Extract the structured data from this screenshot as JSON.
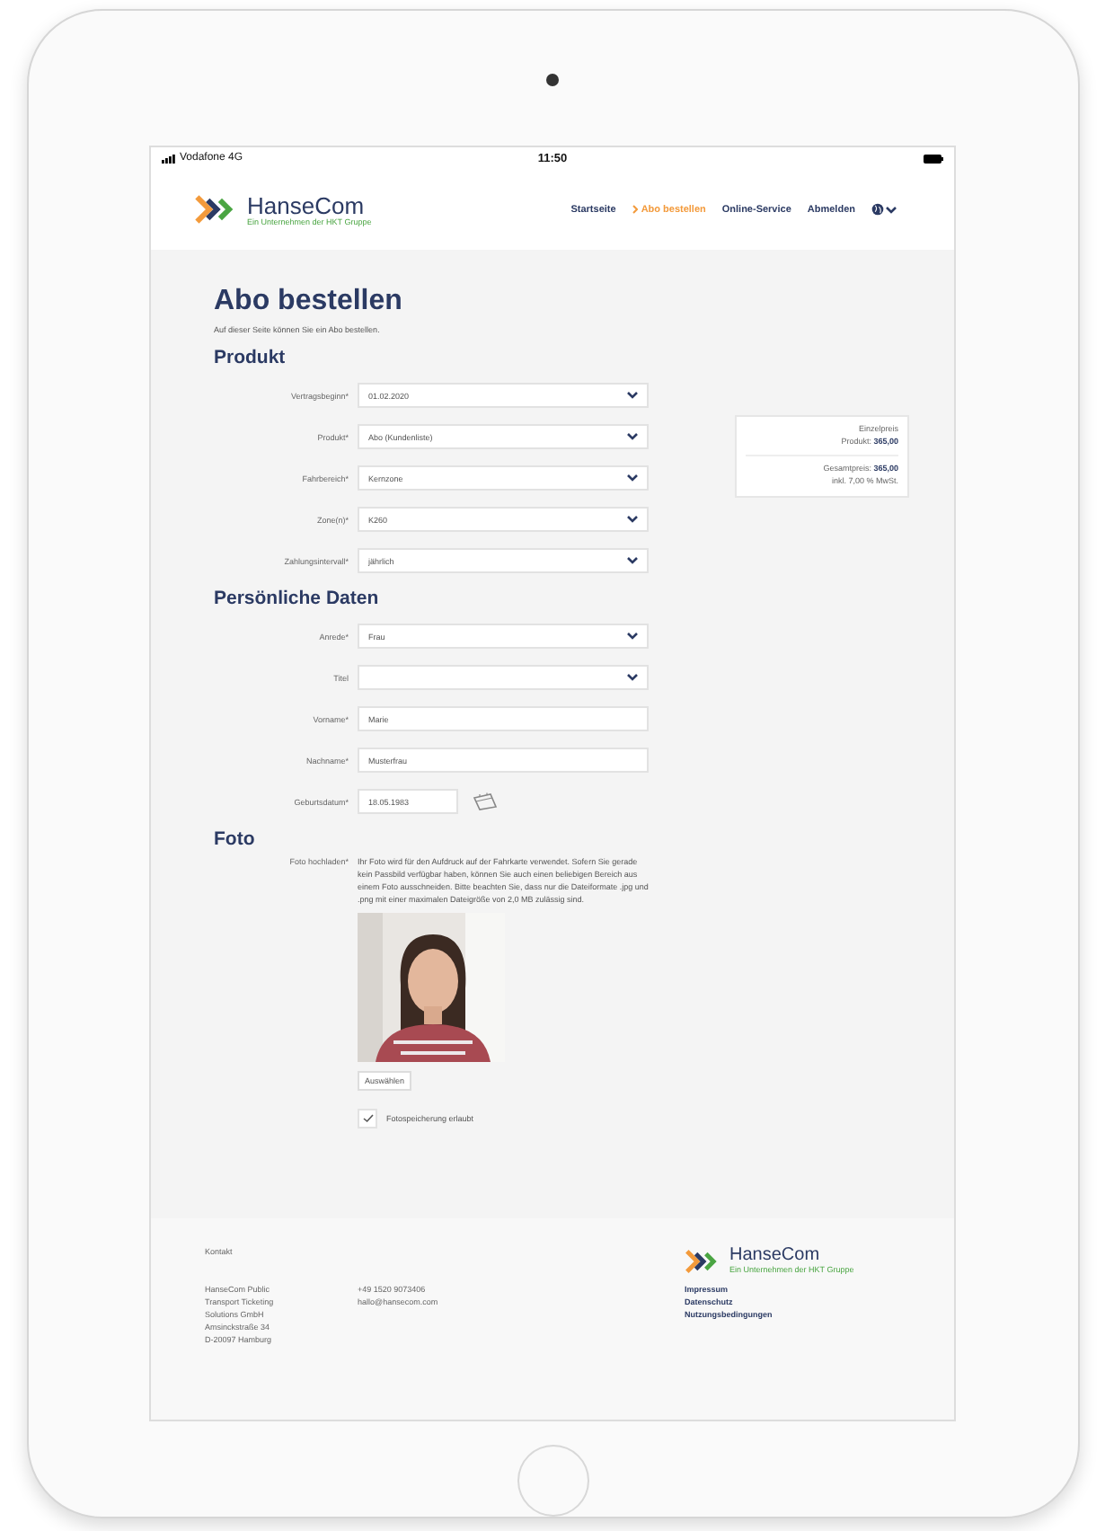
{
  "device": {
    "carrier": "Vodafone 4G",
    "time": "11:50"
  },
  "header": {
    "logo": {
      "name": "HanseCom",
      "tagline": "Ein Unternehmen der HKT Gruppe"
    },
    "nav": [
      {
        "label": "Startseite",
        "selected": false
      },
      {
        "label": "Abo bestellen",
        "selected": true
      },
      {
        "label": "Online-Service",
        "selected": false
      },
      {
        "label": "Abmelden",
        "selected": false
      }
    ]
  },
  "page": {
    "title": "Abo bestellen",
    "intro": "Auf dieser Seite können Sie ein Abo bestellen."
  },
  "sections": [
    {
      "title": "Produkt",
      "fields": [
        {
          "label": "Vertragsbeginn*",
          "kind": "select",
          "value": "01.02.2020"
        },
        {
          "label": "Produkt*",
          "kind": "select",
          "value": "Abo (Kundenliste)"
        },
        {
          "label": "Fahrbereich*",
          "kind": "select",
          "value": "Kernzone"
        },
        {
          "label": "Zone(n)*",
          "kind": "select",
          "value": "K260"
        },
        {
          "label": "Zahlungsintervall*",
          "kind": "select",
          "value": "jährlich"
        }
      ]
    },
    {
      "title": "Persönliche Daten",
      "fields": [
        {
          "label": "Anrede*",
          "kind": "select",
          "value": "Frau"
        },
        {
          "label": "Titel",
          "kind": "select"
        },
        {
          "label": "Vorname*",
          "kind": "text",
          "value": "Marie"
        },
        {
          "label": "Nachname*",
          "kind": "text",
          "value": "Musterfrau"
        },
        {
          "label": "Geburtsdatum*",
          "kind": "date",
          "value": "18.05.1983"
        }
      ]
    }
  ],
  "summary": [
    {
      "lines": [
        "Einzelpreis",
        "Produkt: **365,00**"
      ]
    },
    {
      "lines": [
        "Gesamtpreis: **365,00**",
        "inkl. 7,00 % MwSt."
      ]
    }
  ],
  "photo": {
    "title": "Foto",
    "label": "Foto hochladen*",
    "description": "Ihr Foto wird für den Aufdruck auf der Fahrkarte verwendet. Sofern Sie gerade kein Passbild verfügbar haben, können Sie auch einen beliebigen Bereich aus einem Foto ausschneiden. Bitte beachten Sie, dass nur die Dateiformate .jpg und .png mit einer maximalen Dateigröße von 2,0 MB zulässig sind.",
    "button": "Auswählen",
    "consent": {
      "label": "Fotospeicherung erlaubt",
      "checked": true
    }
  },
  "footer": {
    "heading": "Kontakt",
    "address": [
      "HanseCom Public",
      "Transport Ticketing",
      "Solutions GmbH",
      "Amsinckstraße 34",
      "D-20097 Hamburg"
    ],
    "contact": [
      "+49 1520 9073406",
      "hallo@hansecom.com"
    ],
    "logo": {
      "name": "HanseCom",
      "tagline": "Ein Unternehmen der HKT Gruppe"
    },
    "links": [
      "Impressum",
      "Datenschutz",
      "Nutzungsbedingungen"
    ]
  }
}
